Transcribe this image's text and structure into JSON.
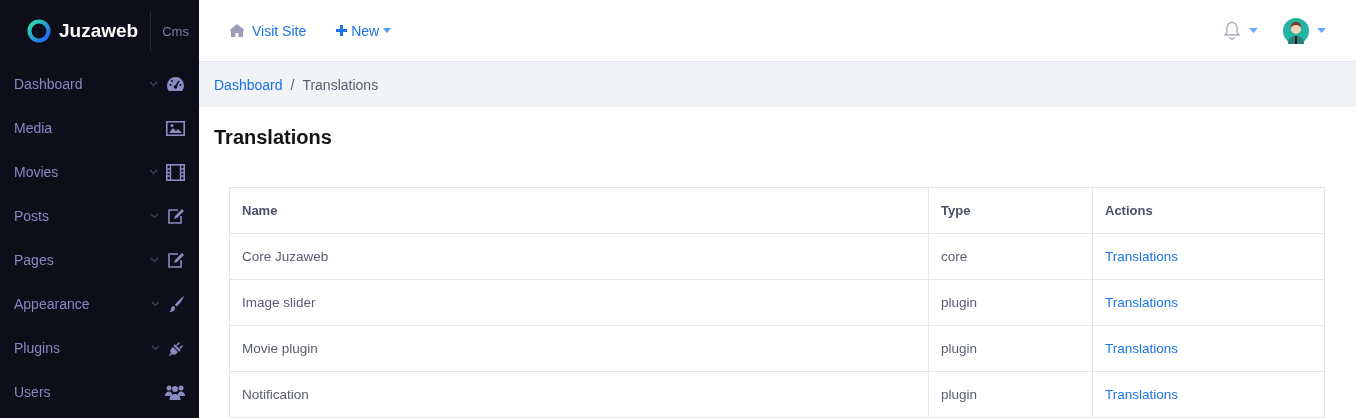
{
  "brand": {
    "name": "Juzaweb",
    "tag": "Cms"
  },
  "sidebar": {
    "items": [
      {
        "label": "Dashboard",
        "expandable": true,
        "kind": "gauge"
      },
      {
        "label": "Media",
        "expandable": false,
        "kind": "image"
      },
      {
        "label": "Movies",
        "expandable": true,
        "kind": "film"
      },
      {
        "label": "Posts",
        "expandable": true,
        "kind": "edit"
      },
      {
        "label": "Pages",
        "expandable": true,
        "kind": "edit"
      },
      {
        "label": "Appearance",
        "expandable": true,
        "kind": "brush"
      },
      {
        "label": "Plugins",
        "expandable": true,
        "kind": "plug"
      },
      {
        "label": "Users",
        "expandable": false,
        "kind": "users"
      }
    ]
  },
  "topbar": {
    "visit_site": "Visit Site",
    "new": "New"
  },
  "breadcrumb": {
    "separator": "/",
    "items": [
      {
        "label": "Dashboard",
        "link": true
      },
      {
        "label": "Translations",
        "link": false
      }
    ]
  },
  "page_title": "Translations",
  "table": {
    "columns": [
      "Name",
      "Type",
      "Actions"
    ],
    "rows": [
      {
        "name": "Core Juzaweb",
        "type": "core",
        "action": "Translations"
      },
      {
        "name": "Image slider",
        "type": "plugin",
        "action": "Translations"
      },
      {
        "name": "Movie plugin",
        "type": "plugin",
        "action": "Translations"
      },
      {
        "name": "Notification",
        "type": "plugin",
        "action": "Translations"
      }
    ]
  }
}
